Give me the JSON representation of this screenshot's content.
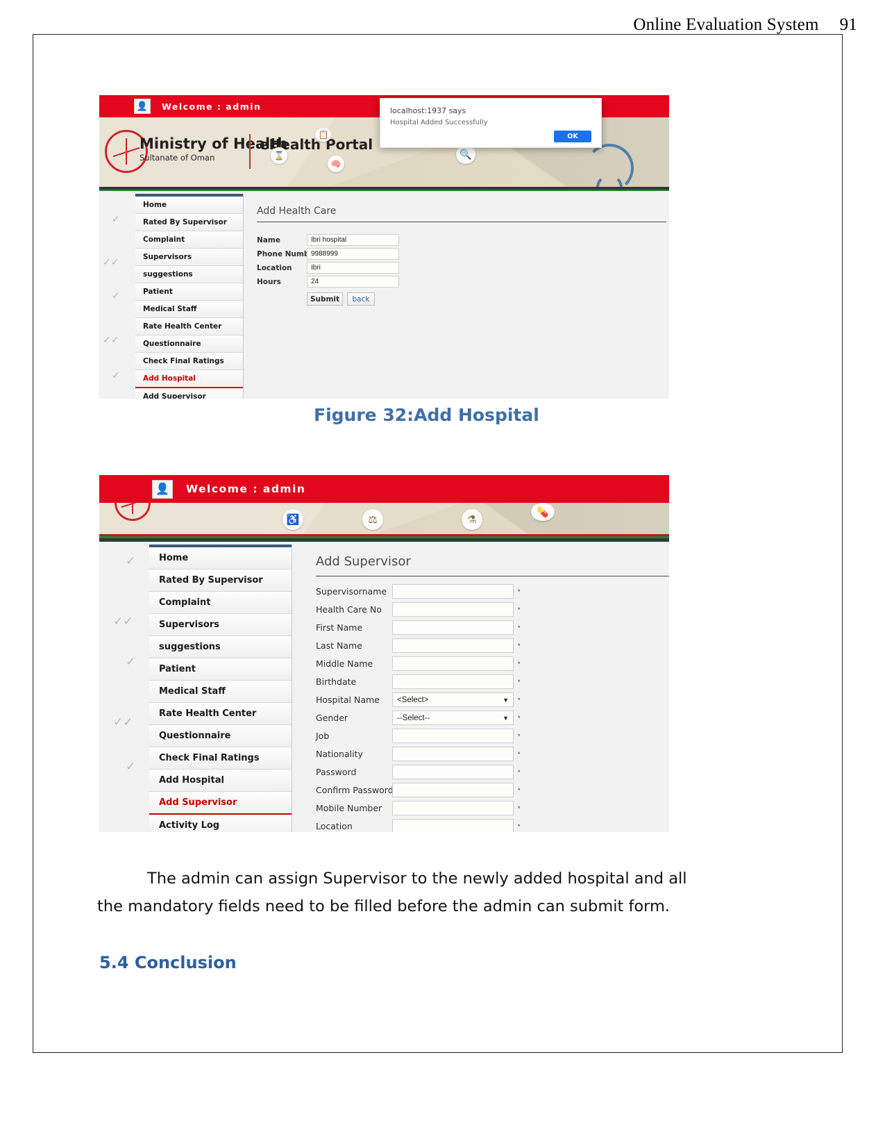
{
  "document": {
    "running_header": {
      "title": "Online Evaluation System",
      "page_number": "91"
    },
    "caption_32": "Figure 32:Add Hospital",
    "paragraph": "The admin can assign Supervisor to the newly added hospital and all the mandatory fields need to be filled before the admin can submit form.",
    "paragraph_line1": "The admin can assign Supervisor to the newly added hospital and all",
    "paragraph_line2": "the mandatory fields need to be filled before the admin can submit form.",
    "section_heading": "5.4 Conclusion"
  },
  "screenshot_add_hospital": {
    "topbar": {
      "welcome": "Welcome : admin",
      "user_icon": "user-icon"
    },
    "banner": {
      "ministry_main": "Ministry of Health",
      "ministry_sub": "Sultanate of Oman",
      "portal": "eHealth Portal",
      "icons": [
        "clipboard-icon",
        "microscope-icon",
        "brain-icon",
        "search-icon",
        "wheelchair-icon",
        "dna-icon",
        "flask-icon",
        "pills-icon",
        "stethoscope-icon"
      ]
    },
    "alert": {
      "origin": "localhost:1937 says",
      "message": "Hospital Added Successfully",
      "ok_label": "OK"
    },
    "sidebar": [
      {
        "label": "Home",
        "active": false
      },
      {
        "label": "Rated By Supervisor",
        "active": false
      },
      {
        "label": "Complaint",
        "active": false
      },
      {
        "label": "Supervisors",
        "active": false
      },
      {
        "label": "suggestions",
        "active": false
      },
      {
        "label": "Patient",
        "active": false
      },
      {
        "label": "Medical Staff",
        "active": false
      },
      {
        "label": "Rate Health Center",
        "active": false
      },
      {
        "label": "Questionnaire",
        "active": false
      },
      {
        "label": "Check Final Ratings",
        "active": false
      },
      {
        "label": "Add Hospital",
        "active": true
      },
      {
        "label": "Add Supervisor",
        "active": false
      }
    ],
    "form": {
      "title": "Add Health Care",
      "fields": [
        {
          "label": "Name",
          "value": "Ibri hospital"
        },
        {
          "label": "Phone Number",
          "value": "9988999"
        },
        {
          "label": "Location",
          "value": "Ibri"
        },
        {
          "label": "Hours",
          "value": "24"
        }
      ],
      "submit_label": "Submit",
      "back_label": "back"
    }
  },
  "screenshot_add_supervisor": {
    "topbar": {
      "welcome": "Welcome : admin",
      "user_icon": "user-icon"
    },
    "banner": {
      "icons": [
        "wheelchair-icon",
        "dna-icon",
        "flask-icon",
        "pills-icon"
      ]
    },
    "sidebar": [
      {
        "label": "Home",
        "active": false
      },
      {
        "label": "Rated By Supervisor",
        "active": false
      },
      {
        "label": "Complaint",
        "active": false
      },
      {
        "label": "Supervisors",
        "active": false
      },
      {
        "label": "suggestions",
        "active": false
      },
      {
        "label": "Patient",
        "active": false
      },
      {
        "label": "Medical Staff",
        "active": false
      },
      {
        "label": "Rate Health Center",
        "active": false
      },
      {
        "label": "Questionnaire",
        "active": false
      },
      {
        "label": "Check Final Ratings",
        "active": false
      },
      {
        "label": "Add Hospital",
        "active": false
      },
      {
        "label": "Add Supervisor",
        "active": true
      },
      {
        "label": "Activity Log",
        "active": false
      }
    ],
    "form": {
      "title": "Add Supervisor",
      "required_marker": "*",
      "fields": [
        {
          "label": "Supervisorname",
          "type": "text",
          "value": "",
          "required": "*"
        },
        {
          "label": "Health Care No",
          "type": "text",
          "value": "",
          "required": "*"
        },
        {
          "label": "First Name",
          "type": "text",
          "value": "",
          "required": "*"
        },
        {
          "label": "Last Name",
          "type": "text",
          "value": "",
          "required": "*"
        },
        {
          "label": "Middle Name",
          "type": "text",
          "value": "",
          "required": "*"
        },
        {
          "label": "Birthdate",
          "type": "text",
          "value": "",
          "required": "*"
        },
        {
          "label": "Hospital Name",
          "type": "select",
          "value": "<Select>",
          "required": "*"
        },
        {
          "label": "Gender",
          "type": "select",
          "value": "--Select--",
          "required": "*"
        },
        {
          "label": "Job",
          "type": "text",
          "value": "",
          "required": "*"
        },
        {
          "label": "Nationality",
          "type": "text",
          "value": "",
          "required": "*"
        },
        {
          "label": "Password",
          "type": "text",
          "value": "",
          "required": "*"
        },
        {
          "label": "Confirm Password",
          "type": "text",
          "value": "",
          "required": "*"
        },
        {
          "label": "Mobile Number",
          "type": "text",
          "value": "",
          "required": "*"
        },
        {
          "label": "Location",
          "type": "text",
          "value": "",
          "required": "*"
        }
      ]
    }
  },
  "colors": {
    "brand_red": "#e2071c",
    "banner_beige": "#ded6bd",
    "accent_blue": "#3f6fa8",
    "dialog_blue": "#1a73e8",
    "active_link_red": "#cc0000"
  }
}
